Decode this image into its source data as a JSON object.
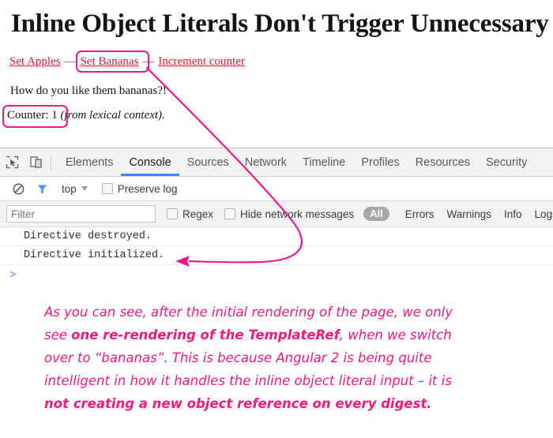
{
  "page": {
    "title": "Inline Object Literals Don't Trigger Unnecessary I",
    "links": [
      {
        "label": "Set Apples",
        "name": "set-apples-link"
      },
      {
        "label": "Set Bananas",
        "name": "set-bananas-link"
      },
      {
        "label": "Increment counter",
        "name": "increment-counter-link"
      }
    ],
    "separator": "—",
    "prompt_text": "How do you like them bananas?!",
    "counter_label": "Counter: 1",
    "counter_note": " (from lexical context)."
  },
  "devtools": {
    "toolbar_icons": [
      {
        "name": "inspect-element-icon"
      },
      {
        "name": "device-toolbar-icon"
      }
    ],
    "tabs": [
      {
        "label": "Elements",
        "active": false
      },
      {
        "label": "Console",
        "active": true
      },
      {
        "label": "Sources",
        "active": false
      },
      {
        "label": "Network",
        "active": false
      },
      {
        "label": "Timeline",
        "active": false
      },
      {
        "label": "Profiles",
        "active": false
      },
      {
        "label": "Resources",
        "active": false
      },
      {
        "label": "Security",
        "active": false
      }
    ],
    "filter_row": {
      "clear_icon": "clear-console-icon",
      "funnel_icon": "filter-funnel-icon",
      "context": "top",
      "preserve_log_label": "Preserve log",
      "preserve_log_checked": false
    },
    "filter_row2": {
      "filter_placeholder": "Filter",
      "filter_value": "",
      "regex_label": "Regex",
      "regex_checked": false,
      "hide_network_label": "Hide network messages",
      "hide_network_checked": false,
      "level_all": "All",
      "levels": [
        "Errors",
        "Warnings",
        "Info",
        "Logs"
      ]
    },
    "console_messages": [
      "Directive destroyed.",
      "Directive initialized."
    ],
    "prompt_glyph": ">"
  },
  "annotation": {
    "line1_a": "As you can see, after the initial rendering of the page, we only",
    "line2_a": "see ",
    "line2_b": "one re-rendering of the TemplateRef",
    "line2_c": ", when we switch",
    "line3_a": "over to “bananas”. This is because Angular 2 is being quite",
    "line4_a": "intelligent in how it handles the inline object literal input – it is",
    "line5_b": "not creating a new object reference on every digest."
  },
  "colors": {
    "annotation_pink": "#f4187f",
    "highlight_pink": "#f0188a",
    "link_red": "#e8162b",
    "tab_active_blue": "#4285f4",
    "prompt_blue": "#5189e0"
  }
}
